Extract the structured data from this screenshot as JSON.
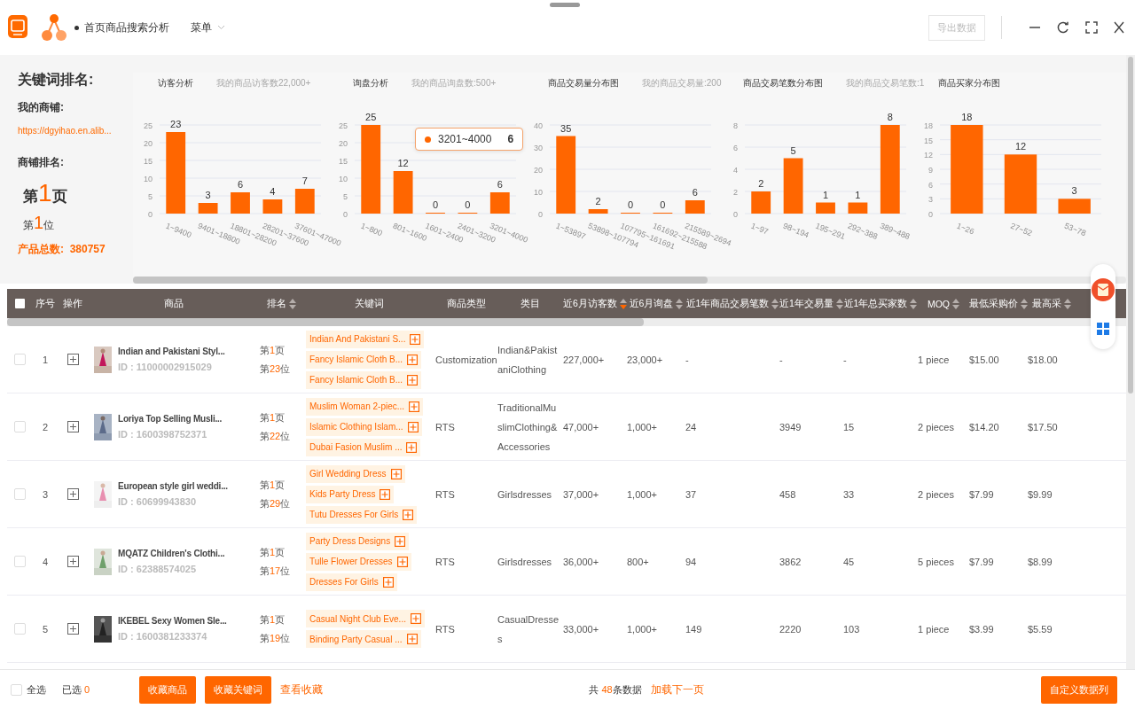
{
  "header": {
    "title": "首页商品搜索分析",
    "menu": "菜单",
    "export_button": {
      "label": "导出数据",
      "disabled": true
    }
  },
  "summary": {
    "heading": "关键词排名:",
    "shop_label": "我的商铺:",
    "shop_link": "https://dgyihao.en.alib...",
    "rank_label": "商铺排名:",
    "page_rank": {
      "pre": "第",
      "num": "1",
      "post": "页"
    },
    "position_rank": {
      "pre": "第",
      "num": "1",
      "post": "位"
    },
    "total": "产品总数:  380757"
  },
  "charts": [
    {
      "title": "访客分析",
      "note": "我的商品访客数22,000+",
      "chart_data": {
        "type": "bar",
        "categories": [
          "1~9400",
          "9401~18800",
          "18801~28200",
          "28201~37600",
          "37601~47000"
        ],
        "values": [
          23,
          3,
          6,
          4,
          7
        ],
        "ylim": [
          0,
          25
        ],
        "yticks": [
          0,
          5,
          10,
          15,
          20,
          25
        ],
        "grid": true,
        "data_labels": true
      }
    },
    {
      "title": "询盘分析",
      "note": "我的商品询盘数:500+",
      "chart_data": {
        "type": "bar",
        "categories": [
          "1~800",
          "801~1600",
          "1601~2400",
          "2401~3200",
          "3201~4000"
        ],
        "values": [
          25,
          12,
          0,
          0,
          6
        ],
        "ylim": [
          0,
          25
        ],
        "yticks": [
          0,
          5,
          10,
          15,
          20,
          25
        ],
        "grid": true,
        "data_labels": true
      },
      "tooltip": {
        "label": "3201~4000",
        "value": "6",
        "color": "#ff6600"
      }
    },
    {
      "title": "商品交易量分布图",
      "note": "我的商品交易量:200",
      "chart_data": {
        "type": "bar",
        "categories": [
          "1~53897",
          "53898~107794",
          "107795~161691",
          "161692~215588",
          "215589~2694"
        ],
        "values": [
          35,
          2,
          0,
          0,
          6
        ],
        "ylim": [
          0,
          40
        ],
        "yticks": [
          0,
          10,
          20,
          30,
          40
        ],
        "grid": true,
        "data_labels": true
      }
    },
    {
      "title": "商品交易笔数分布图",
      "note": "我的商品交易笔数:1",
      "chart_data": {
        "type": "bar",
        "categories": [
          "1~97",
          "98~194",
          "195~291",
          "292~388",
          "389~488"
        ],
        "values": [
          2,
          5,
          1,
          1,
          8
        ],
        "ylim": [
          0,
          8
        ],
        "yticks": [
          0,
          2,
          4,
          6,
          8
        ],
        "grid": true,
        "data_labels": true
      }
    },
    {
      "title": "商品买家分布图",
      "chart_data": {
        "type": "bar",
        "categories": [
          "1~26",
          "27~52",
          "53~78"
        ],
        "values": [
          18,
          12,
          3
        ],
        "ylim": [
          0,
          18
        ],
        "yticks": [
          0,
          3,
          6,
          9,
          12,
          15,
          18
        ],
        "grid": true,
        "data_labels": true
      }
    }
  ],
  "table": {
    "select_all_checked": false,
    "columns": [
      {
        "kind": "check"
      },
      {
        "label": "序号"
      },
      {
        "label": "操作"
      },
      {
        "label": "商品"
      },
      {
        "label": "排名",
        "sorted": false
      },
      {
        "label": "关键词"
      },
      {
        "label": "商品类型"
      },
      {
        "label": "类目"
      },
      {
        "label": "近6月访客数",
        "sorted": true
      },
      {
        "label": "近6月询盘",
        "sorted": false
      },
      {
        "label": "近1年商品交易笔数",
        "sorted": false
      },
      {
        "label": "近1年交易量",
        "sorted": false
      },
      {
        "label": "近1年总买家数",
        "sorted": false
      },
      {
        "label": "MOQ",
        "sorted": false
      },
      {
        "label": "最低采购价",
        "sorted": false
      },
      {
        "label": "最高采",
        "sorted": false
      }
    ],
    "rows": [
      {
        "checked": false,
        "no": "1",
        "name": "Indian and Pakistani Styl...",
        "id": "ID : 11000002915029",
        "rank_page": {
          "pre": "第",
          "num": "1",
          "post": "页"
        },
        "rank_pos": {
          "pre": "第",
          "num": "23",
          "post": "位"
        },
        "keywords": [
          "Indian And Pakistani S...",
          "Fancy Islamic Cloth B...",
          "Fancy Islamic Cloth B..."
        ],
        "type": "Customization",
        "category": "Indian&PakistaniClothing",
        "visitors": "227,000+",
        "inquiries": "23,000+",
        "orders": "-",
        "volume": "-",
        "buyers": "-",
        "moq": "1 piece",
        "min_price": "$15.00",
        "max_price": "$18.00"
      },
      {
        "checked": false,
        "no": "2",
        "name": "Loriya Top Selling Musli...",
        "id": "ID : 1600398752371",
        "rank_page": {
          "pre": "第",
          "num": "1",
          "post": "页"
        },
        "rank_pos": {
          "pre": "第",
          "num": "22",
          "post": "位"
        },
        "keywords": [
          "Muslim Woman 2-piec...",
          "Islamic Clothing Islam...",
          "Dubai Fasion Muslim ..."
        ],
        "type": "RTS",
        "category": "TraditionalMuslimClothing&Accessories",
        "visitors": "47,000+",
        "inquiries": "1,000+",
        "orders": "24",
        "volume": "3949",
        "buyers": "15",
        "moq": "2 pieces",
        "min_price": "$14.20",
        "max_price": "$17.50"
      },
      {
        "checked": false,
        "no": "3",
        "name": "European style girl weddi...",
        "id": "ID : 60699943830",
        "rank_page": {
          "pre": "第",
          "num": "1",
          "post": "页"
        },
        "rank_pos": {
          "pre": "第",
          "num": "29",
          "post": "位"
        },
        "keywords": [
          "Girl Wedding Dress",
          "Kids Party Dress",
          "Tutu Dresses For Girls"
        ],
        "type": "RTS",
        "category": "Girlsdresses",
        "visitors": "37,000+",
        "inquiries": "1,000+",
        "orders": "37",
        "volume": "458",
        "buyers": "33",
        "moq": "2 pieces",
        "min_price": "$7.99",
        "max_price": "$9.99"
      },
      {
        "checked": false,
        "no": "4",
        "name": "MQATZ Children's Clothi...",
        "id": "ID : 62388574025",
        "rank_page": {
          "pre": "第",
          "num": "1",
          "post": "页"
        },
        "rank_pos": {
          "pre": "第",
          "num": "17",
          "post": "位"
        },
        "keywords": [
          "Party Dress Designs",
          "Tulle Flower Dresses",
          "Dresses For Girls"
        ],
        "type": "RTS",
        "category": "Girlsdresses",
        "visitors": "36,000+",
        "inquiries": "800+",
        "orders": "94",
        "volume": "3862",
        "buyers": "45",
        "moq": "5 pieces",
        "min_price": "$7.99",
        "max_price": "$8.99"
      },
      {
        "checked": false,
        "no": "5",
        "name": "IKEBEL Sexy Women Sle...",
        "id": "ID : 1600381233374",
        "rank_page": {
          "pre": "第",
          "num": "1",
          "post": "页"
        },
        "rank_pos": {
          "pre": "第",
          "num": "19",
          "post": "位"
        },
        "keywords": [
          "Casual Night Club Eve...",
          "Binding Party Casual ..."
        ],
        "type": "RTS",
        "category": "CasualDresses",
        "visitors": "33,000+",
        "inquiries": "1,000+",
        "orders": "149",
        "volume": "2220",
        "buyers": "103",
        "moq": "1 piece",
        "min_price": "$3.99",
        "max_price": "$5.59"
      }
    ]
  },
  "footer": {
    "select_all": {
      "label": "全选",
      "checked": false
    },
    "selected": {
      "label": "已选",
      "count": "0"
    },
    "buttons": [
      "收藏商品",
      "收藏关键词"
    ],
    "favorites_link": "查看收藏",
    "total": {
      "pre": "共",
      "num": "48",
      "post": "条数据"
    },
    "load_more": "加载下一页",
    "custom_button": "自定义数据列"
  }
}
